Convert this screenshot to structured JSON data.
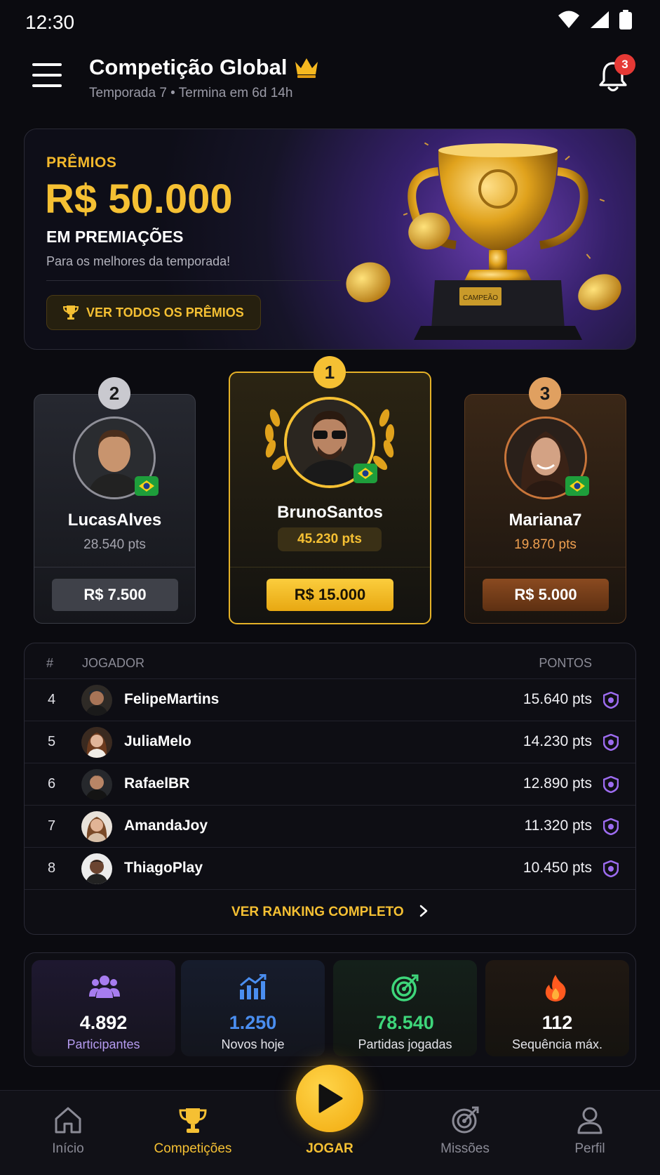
{
  "status": {
    "time": "12:30"
  },
  "header": {
    "title": "Competição Global",
    "subtitle": "Temporada 7 • Termina em 6d 14h",
    "notifications": "3"
  },
  "prize": {
    "label": "PRÊMIOS",
    "amount": "R$ 50.000",
    "sub": "EM PREMIAÇÕES",
    "desc": "Para os melhores da temporada!",
    "button": "VER TODOS OS PRÊMIOS",
    "trophy_plate": "CAMPEÃO"
  },
  "podium": [
    {
      "rank": "2",
      "name": "LucasAlves",
      "points": "28.540 pts",
      "prize": "R$ 7.500"
    },
    {
      "rank": "1",
      "name": "BrunoSantos",
      "points": "45.230 pts",
      "prize": "R$ 15.000"
    },
    {
      "rank": "3",
      "name": "Mariana7",
      "points": "19.870 pts",
      "prize": "R$ 5.000"
    }
  ],
  "leaderboard": {
    "col_rank": "#",
    "col_player": "JOGADOR",
    "col_points": "PONTOS",
    "rows": [
      {
        "rank": "4",
        "name": "FelipeMartins",
        "points": "15.640 pts"
      },
      {
        "rank": "5",
        "name": "JuliaMelo",
        "points": "14.230 pts"
      },
      {
        "rank": "6",
        "name": "RafaelBR",
        "points": "12.890 pts"
      },
      {
        "rank": "7",
        "name": "AmandaJoy",
        "points": "11.320 pts"
      },
      {
        "rank": "8",
        "name": "ThiagoPlay",
        "points": "10.450 pts"
      }
    ],
    "link": "VER RANKING COMPLETO"
  },
  "stats": [
    {
      "value": "4.892",
      "label": "Participantes",
      "color": "#a77cf0"
    },
    {
      "value": "1.250",
      "label": "Novos hoje",
      "color": "#4a8ef0"
    },
    {
      "value": "78.540",
      "label": "Partidas jogadas",
      "color": "#3ed67a"
    },
    {
      "value": "112",
      "label": "Sequência máx.",
      "color": "#ff6a2a"
    }
  ],
  "nav": {
    "home": "Início",
    "competitions": "Competições",
    "play": "JOGAR",
    "missions": "Missões",
    "profile": "Perfil"
  },
  "colors": {
    "accent": "#f5c033",
    "background": "#0b0b10",
    "badge": "#e53935"
  }
}
